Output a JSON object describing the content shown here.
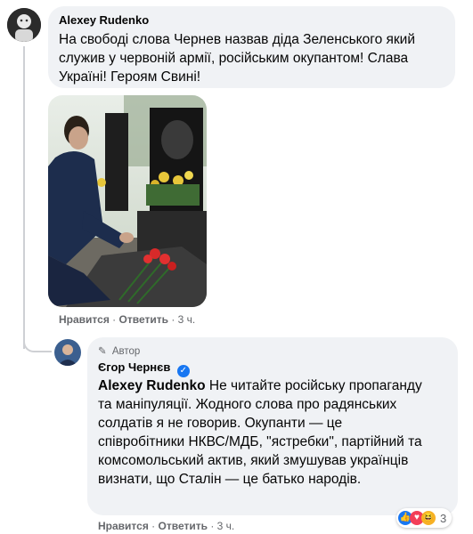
{
  "comment1": {
    "author": "Alexey Rudenko",
    "text": "На свободі слова Чернев назвав діда Зеленського який служив у червоній армії, російським окупантом! Слава Україні! Героям Свині!",
    "actions": {
      "like": "Нравится",
      "sep1": "·",
      "reply": "Ответить",
      "sep2": "·",
      "time": "3 ч."
    }
  },
  "reply": {
    "author_badge": "Автор",
    "author": "Єгор Чернєв",
    "mention": "Alexey Rudenko",
    "text": " Не читайте російську пропаганду та маніпуляції. Жодного слова про радянських солдатів я не говорив. Окупанти — це співробітники НКВС/МДБ, \"ястребки\", партійний та комсомольський актив, який змушував українців визнати, що Сталін — це батько народів.",
    "reaction_count": "3",
    "actions": {
      "like": "Нравится",
      "sep1": "·",
      "reply": "Ответить",
      "sep2": "·",
      "time": "3 ч."
    }
  },
  "colors": {
    "bubble": "#f0f2f5",
    "verified": "#1877f2",
    "meta": "#65676b"
  }
}
